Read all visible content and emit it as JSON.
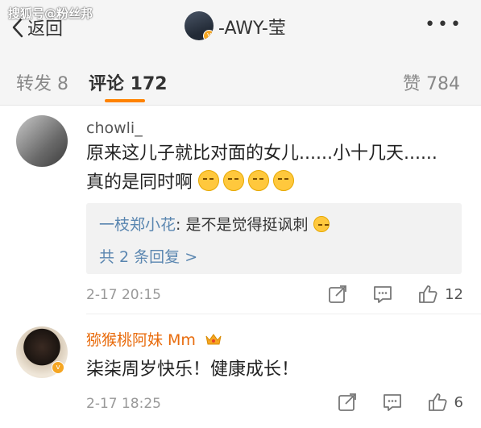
{
  "watermark": "搜狐号@粉丝邦",
  "header": {
    "back_label": "返回",
    "title": "-AWY-莹"
  },
  "tabs": {
    "forward": "转发 8",
    "comment": "评论 172",
    "like": "赞 784",
    "accent": "#ff8200"
  },
  "comments": [
    {
      "user": "chowli_",
      "text": "原来这儿子就比对面的女儿......小十几天......真的是同时啊",
      "emojis": 4,
      "reply": {
        "user": "一枝郑小花",
        "text": ": 是不是觉得挺讽刺",
        "more": "共 2 条回复 >"
      },
      "time": "2-17 20:15",
      "likes": "12"
    },
    {
      "user": "猕猴桃阿妹 Mm",
      "text": "柒柒周岁快乐！健康成长！",
      "time": "2-17 18:25",
      "likes": "6"
    }
  ]
}
